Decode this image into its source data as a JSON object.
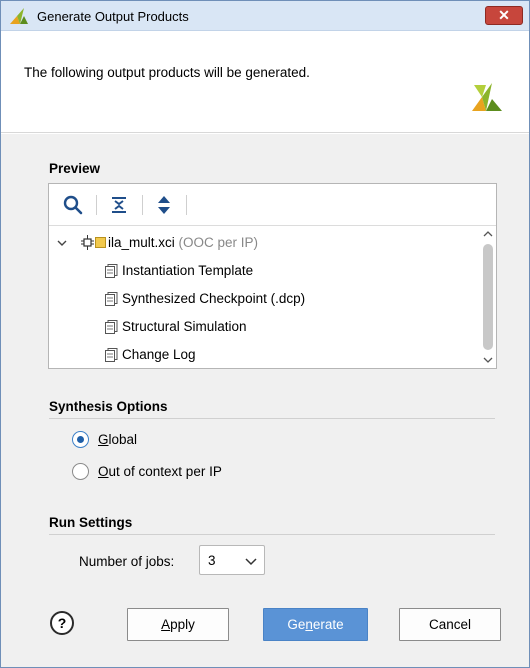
{
  "window": {
    "title": "Generate Output Products",
    "close_glyph": "✕"
  },
  "header": {
    "message": "The following output products will be generated."
  },
  "preview": {
    "heading": "Preview",
    "toolbar": [
      "search-icon",
      "collapse-all-icon",
      "expand-all-icon"
    ],
    "tree": {
      "root": {
        "name": "ila_mult.xci",
        "suffix": "(OOC per IP)",
        "expanded": true
      },
      "children": [
        "Instantiation Template",
        "Synthesized Checkpoint (.dcp)",
        "Structural Simulation",
        "Change Log"
      ]
    }
  },
  "synthesis": {
    "heading": "Synthesis Options",
    "options": [
      {
        "mnemonic": "G",
        "rest": "lobal",
        "checked": true
      },
      {
        "mnemonic": "O",
        "rest": "ut of context per IP",
        "checked": false
      }
    ]
  },
  "run_settings": {
    "heading": "Run Settings",
    "jobs_label_pre": "Number of ",
    "jobs_label_mn": "j",
    "jobs_label_post": "obs:",
    "jobs_value": "3"
  },
  "buttons": {
    "help": "?",
    "apply_mn": "A",
    "apply_rest": "pply",
    "generate_pre": "Ge",
    "generate_mn": "n",
    "generate_post": "erate",
    "cancel": "Cancel"
  },
  "colors": {
    "accent": "#5a93d6",
    "title_bar": "#d9e6f5",
    "close": "#c7463c",
    "ooc_gray": "#888888"
  }
}
